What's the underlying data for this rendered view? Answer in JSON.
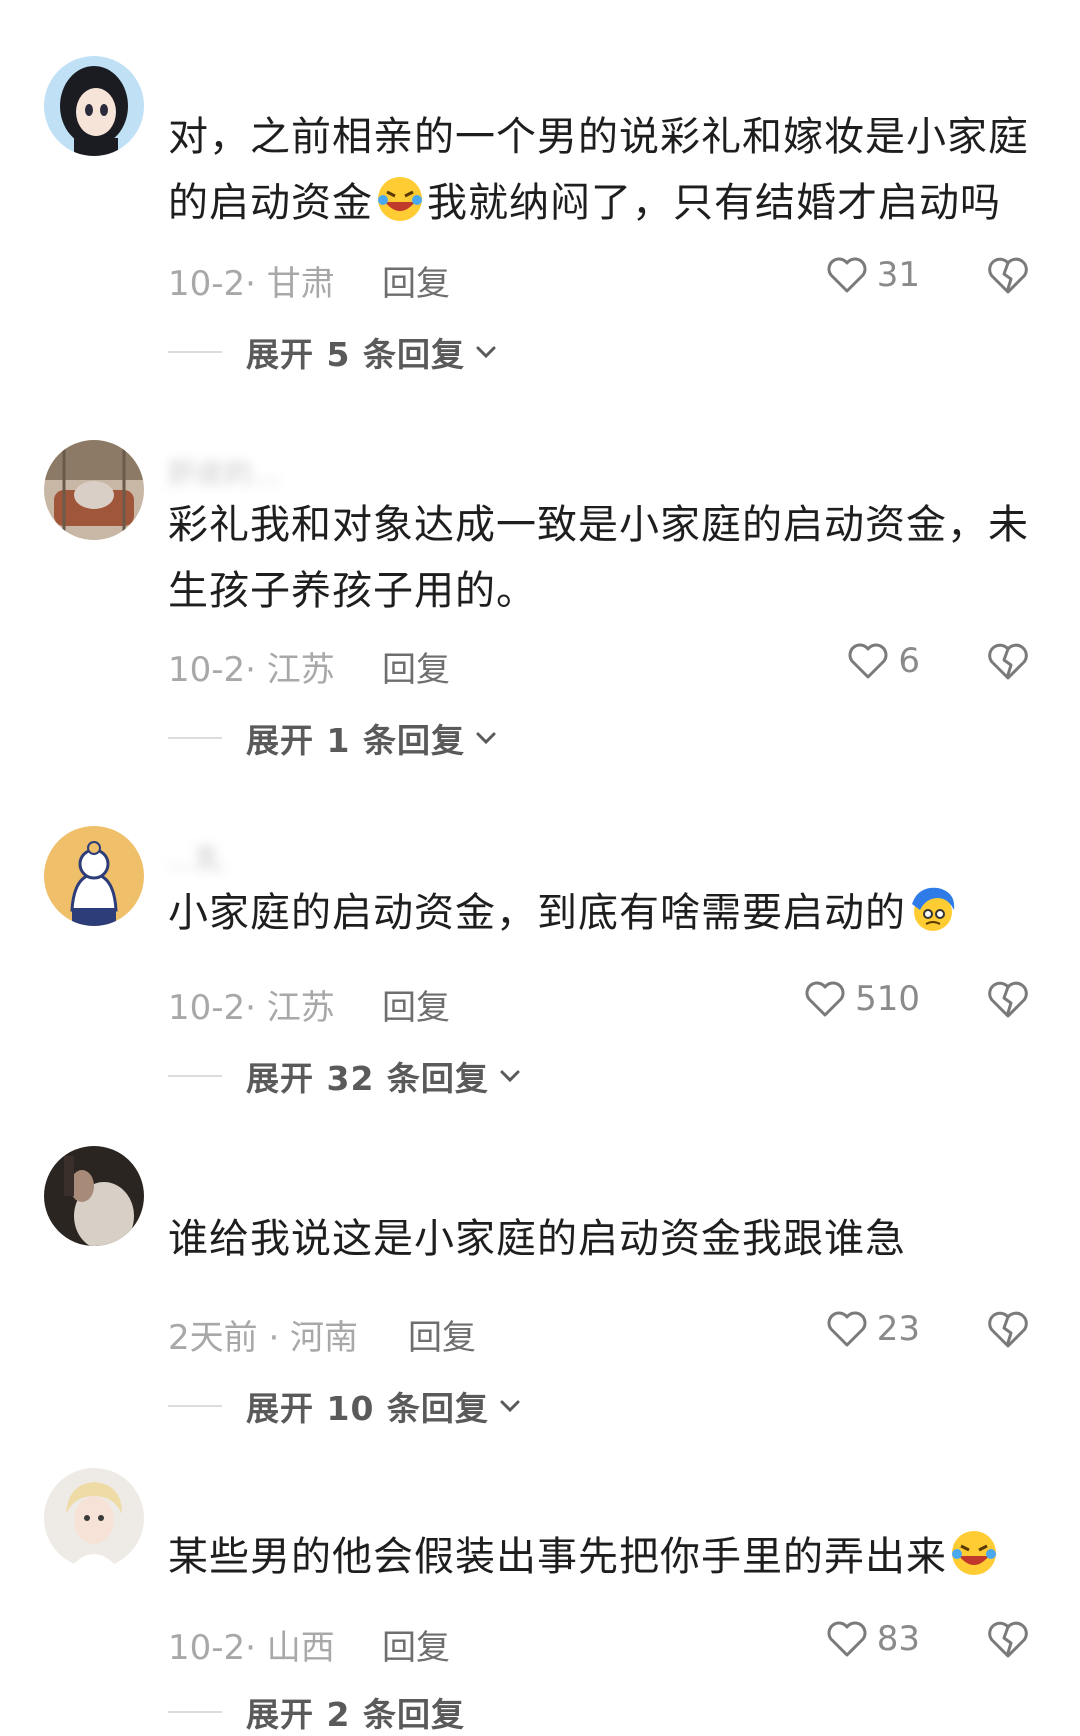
{
  "comments": [
    {
      "username": "",
      "text_lines": [
        "对，之前相亲的一个男的说彩礼和嫁妆是小家庭",
        "的启动资金",
        "我就纳闷了，只有结婚才启动吗"
      ],
      "emoji": "rofl-emoji",
      "time_location": "10-2· 甘肃",
      "reply_label": "回复",
      "likes": "31",
      "expand_label": "展开 5 条回复"
    },
    {
      "username": "肝疣的...",
      "text_lines": [
        "彩礼我和对象达成一致是小家庭的启动资金，未",
        "生孩子养孩子用的。"
      ],
      "time_location": "10-2· 江苏",
      "reply_label": "回复",
      "likes": "6",
      "expand_label": "展开 1 条回复"
    },
    {
      "username": "...乳",
      "text_lines": [
        "小家庭的启动资金，到底有啥需要启动的"
      ],
      "emoji": "confused-blue-emoji",
      "time_location": "10-2· 江苏",
      "reply_label": "回复",
      "likes": "510",
      "expand_label": "展开 32 条回复"
    },
    {
      "username": "",
      "text_lines": [
        "谁给我说这是小家庭的启动资金我跟谁急"
      ],
      "time_location": "2天前 · 河南",
      "reply_label": "回复",
      "likes": "23",
      "expand_label": "展开 10 条回复"
    },
    {
      "username": "",
      "text_lines": [
        "某些男的他会假装出事先把你手里的弄出来"
      ],
      "emoji": "rofl-emoji",
      "time_location": "10-2· 山西",
      "reply_label": "回复",
      "likes": "83",
      "expand_label": "展开 2 条回复"
    }
  ],
  "colors": {
    "text": "#1e1e1e",
    "meta": "#a8a8a8",
    "icon": "#7a7a7a",
    "divider": "#dcdcdc"
  }
}
